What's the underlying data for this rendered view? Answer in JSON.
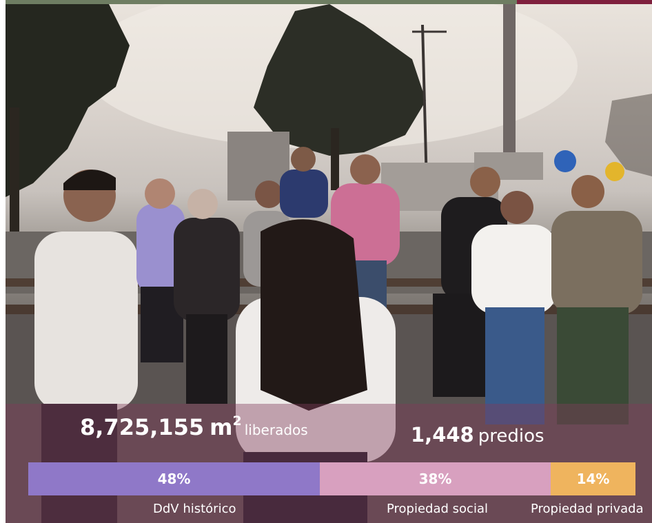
{
  "colors": {
    "top_left_line": "#6e7d62",
    "top_right_line": "#7e1f3d",
    "historic": "#8f78c8",
    "social": "#d8a0bf",
    "private": "#efb45e"
  },
  "stats": {
    "area_value": "8,725,155",
    "area_unit": "m",
    "area_exp": "2",
    "area_word": "liberados",
    "parcels_value": "1,448",
    "parcels_word": "predios"
  },
  "breakdown": [
    {
      "percent_label": "48%",
      "share": 48,
      "category": "DdV histórico"
    },
    {
      "percent_label": "38%",
      "share": 38,
      "category": "Propiedad social"
    },
    {
      "percent_label": "14%",
      "share": 14,
      "category": "Propiedad privada"
    }
  ]
}
